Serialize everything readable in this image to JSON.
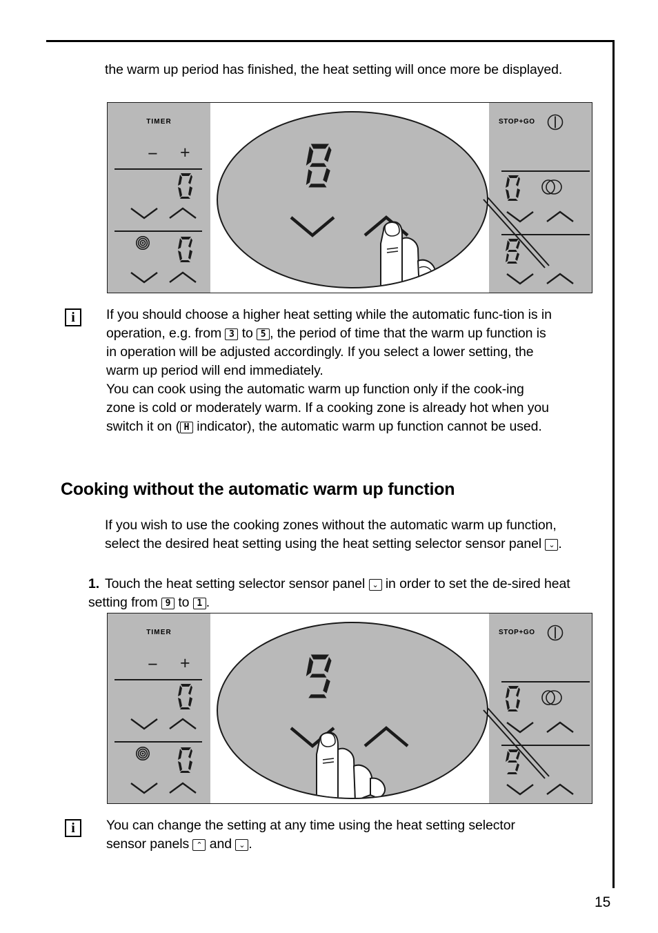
{
  "document": {
    "page_number": "15",
    "intro_text": "the warm up period has finished, the heat setting will once more be displayed.",
    "heading": "Cooking without the automatic warm up function",
    "paragraph": "If you wish to use the cooking zones without the automatic warm up function, select the desired heat setting using the heat setting selector sensor panel ▾.",
    "step": {
      "number": "1.",
      "text": "Touch the heat setting selector sensor panel ▾ in order to set the desired heat setting from ⓪ to ①."
    }
  },
  "notes": [
    {
      "icon": "i",
      "text": "If you should choose a higher heat setting while the automatic function is in operation, e.g. from 3 to 5, the period of time that the warm up function is in operation will be adjusted accordingly. If you select a lower setting, the warm up period will end immediately. You can cook using the automatic warm up function only if the cooking zone is cold or moderately warm. If a cooking zone is already hot when you switch it on (H indicator), the automatic warm up function cannot be used."
    },
    {
      "icon": "i",
      "text": "You can change the setting at any time using the heat setting selector sensor panels ▴ and ▾."
    }
  ],
  "inline_keys": {
    "three": "3",
    "five": "5",
    "hot_indicator": "H",
    "nine": "9",
    "one": "1",
    "chevron_down": "⌄",
    "chevron_up": "⌃"
  },
  "figures": [
    {
      "name": "figure-warm-up-8",
      "left_panel": {
        "title": "TIMER",
        "minus": "−",
        "plus": "+",
        "timer_display": "0",
        "zone_display": "0",
        "zone_icon": "cooking-zone-spiral-icon"
      },
      "magnifier": {
        "display": "8",
        "chevron_left": "down",
        "chevron_right": "up",
        "finger_on": "up"
      },
      "right_panel": {
        "title": "STOP+GO",
        "power_icon": "power-on-off-icon",
        "display_top": "0",
        "dual_zone_icon": "dual-circle-icon",
        "display_bottom": "8"
      }
    },
    {
      "name": "figure-manual-9",
      "left_panel": {
        "title": "TIMER",
        "minus": "−",
        "plus": "+",
        "timer_display": "0",
        "zone_display": "0",
        "zone_icon": "cooking-zone-spiral-icon"
      },
      "magnifier": {
        "display": "9",
        "chevron_left": "down",
        "chevron_right": "up",
        "finger_on": "down"
      },
      "right_panel": {
        "title": "STOP+GO",
        "power_icon": "power-on-off-icon",
        "display_top": "0",
        "dual_zone_icon": "dual-circle-icon",
        "display_bottom": "9"
      }
    }
  ],
  "colors": {
    "panel_gray": "#b9b9b9",
    "ink": "#1a1a1a",
    "page_background": "#ffffff"
  }
}
